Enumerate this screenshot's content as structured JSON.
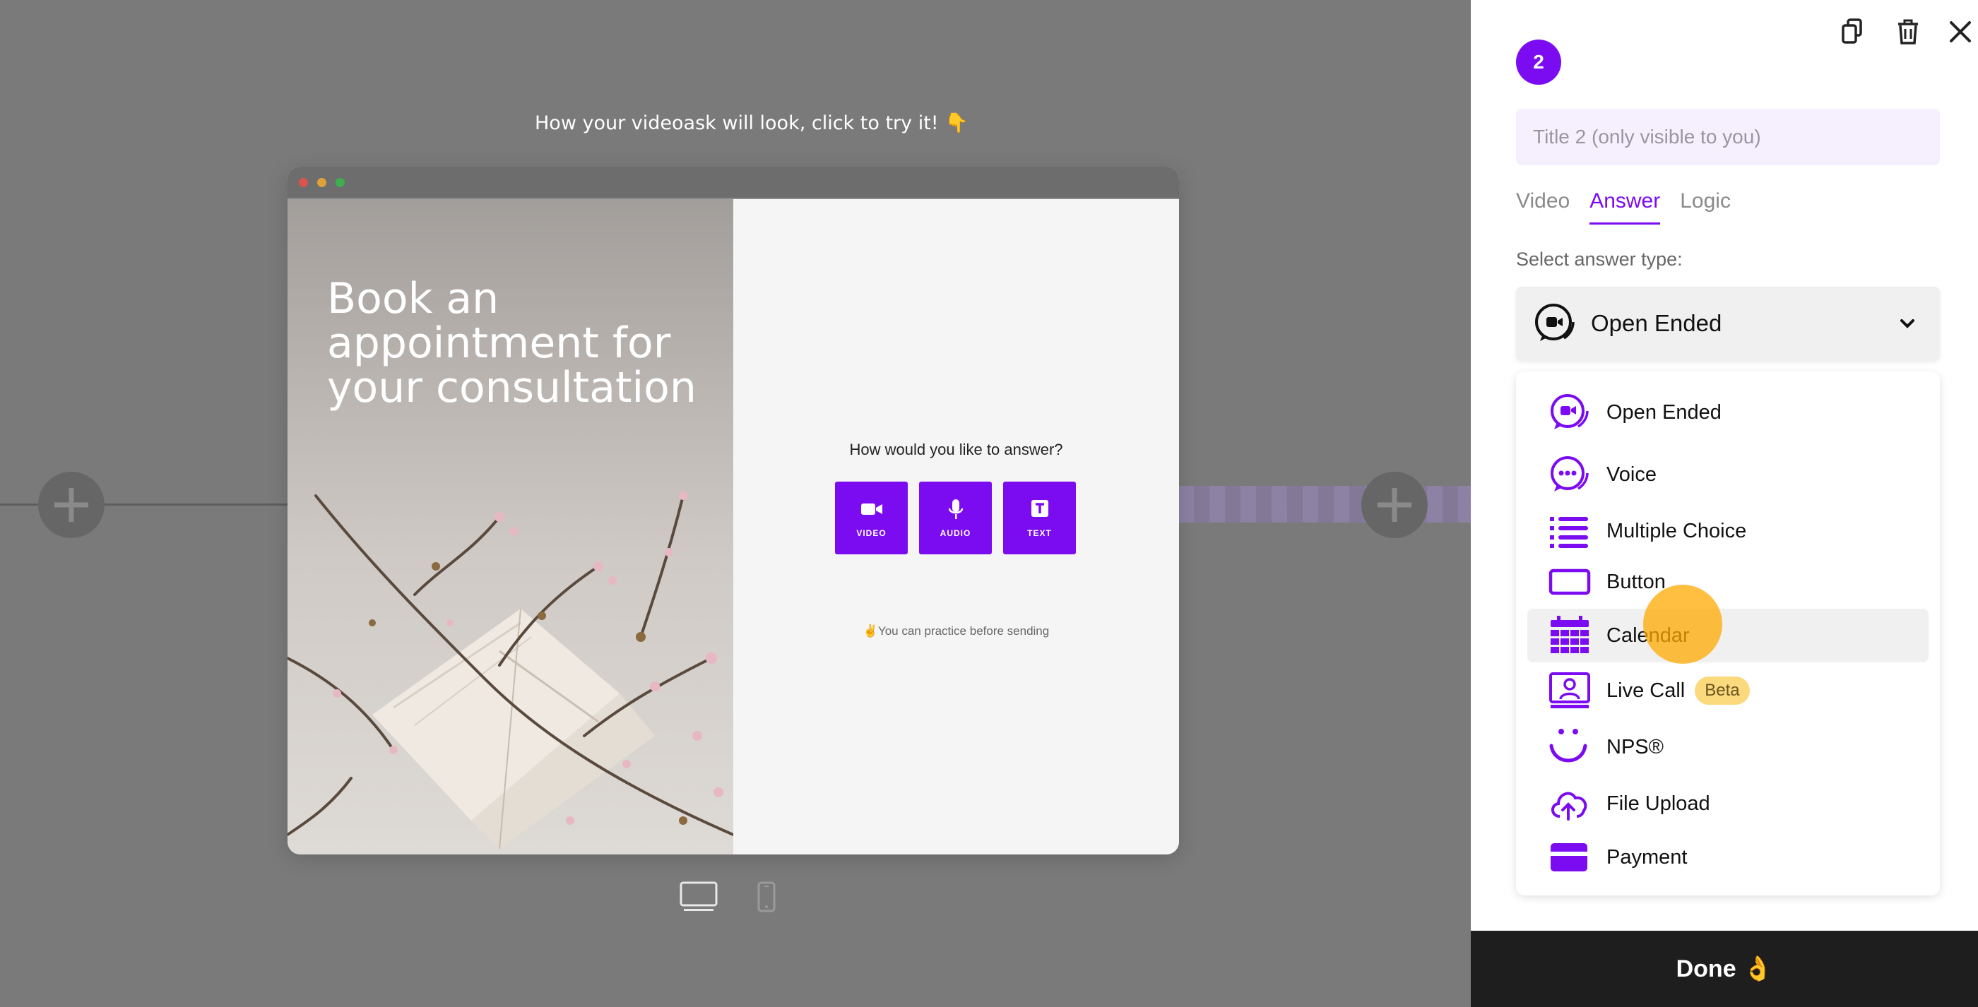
{
  "canvas": {
    "preview_hint": "How your videoask will look, click to try it! 👇",
    "headline": "Book an appointment for your consultation",
    "question": "How would you like to answer?",
    "answer_buttons": [
      {
        "label": "VIDEO",
        "icon": "video-camera-icon"
      },
      {
        "label": "AUDIO",
        "icon": "microphone-icon"
      },
      {
        "label": "TEXT",
        "icon": "text-icon"
      }
    ],
    "practice_note": "✌You can practice before sending",
    "devices": {
      "desktop_icon": "desktop-icon",
      "mobile_icon": "mobile-icon"
    }
  },
  "panel": {
    "step_number": "2",
    "title_placeholder": "Title 2 (only visible to you)",
    "tabs": [
      "Video",
      "Answer",
      "Logic"
    ],
    "active_tab": "Answer",
    "select_label": "Select answer type:",
    "selected_type": "Open Ended",
    "options": [
      {
        "label": "Open Ended",
        "icon": "open-ended-icon"
      },
      {
        "label": "Voice",
        "icon": "voice-icon"
      },
      {
        "label": "Multiple Choice",
        "icon": "list-icon"
      },
      {
        "label": "Button",
        "icon": "button-icon"
      },
      {
        "label": "Calendar",
        "icon": "calendar-icon"
      },
      {
        "label": "Live Call",
        "icon": "live-call-icon",
        "badge": "Beta"
      },
      {
        "label": "NPS®",
        "icon": "smile-icon"
      },
      {
        "label": "File Upload",
        "icon": "upload-icon"
      },
      {
        "label": "Payment",
        "icon": "payment-icon"
      }
    ],
    "hovered_option": "Calendar",
    "done_label": "Done 👌",
    "top_icons": [
      "duplicate-icon",
      "trash-icon",
      "close-icon"
    ]
  },
  "colors": {
    "accent": "#7b0cf2",
    "badge": "#fbd97d",
    "done_bg": "#1e1e1e"
  }
}
